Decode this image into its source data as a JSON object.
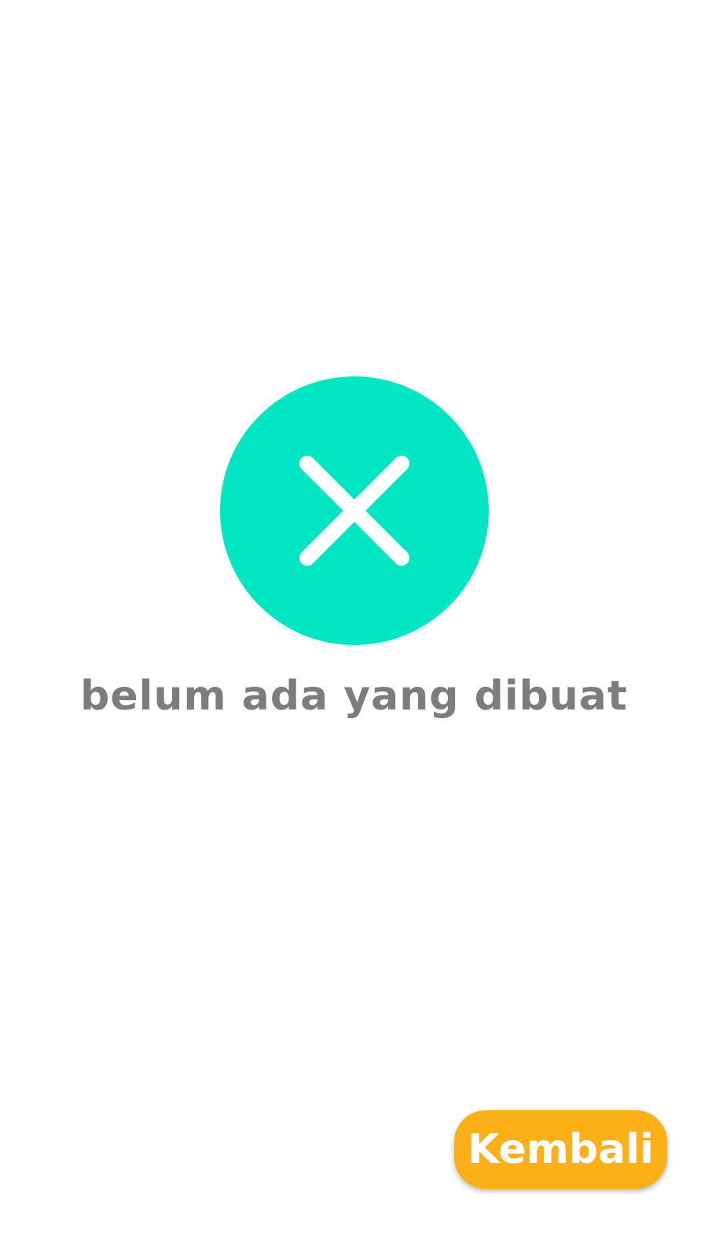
{
  "empty_state": {
    "icon": "close-icon",
    "icon_circle_color": "#03E6C4",
    "icon_glyph_color": "#ffffff",
    "message": "belum ada yang dibuat"
  },
  "back_button": {
    "label": "Kembali",
    "color": "#FBB017"
  }
}
